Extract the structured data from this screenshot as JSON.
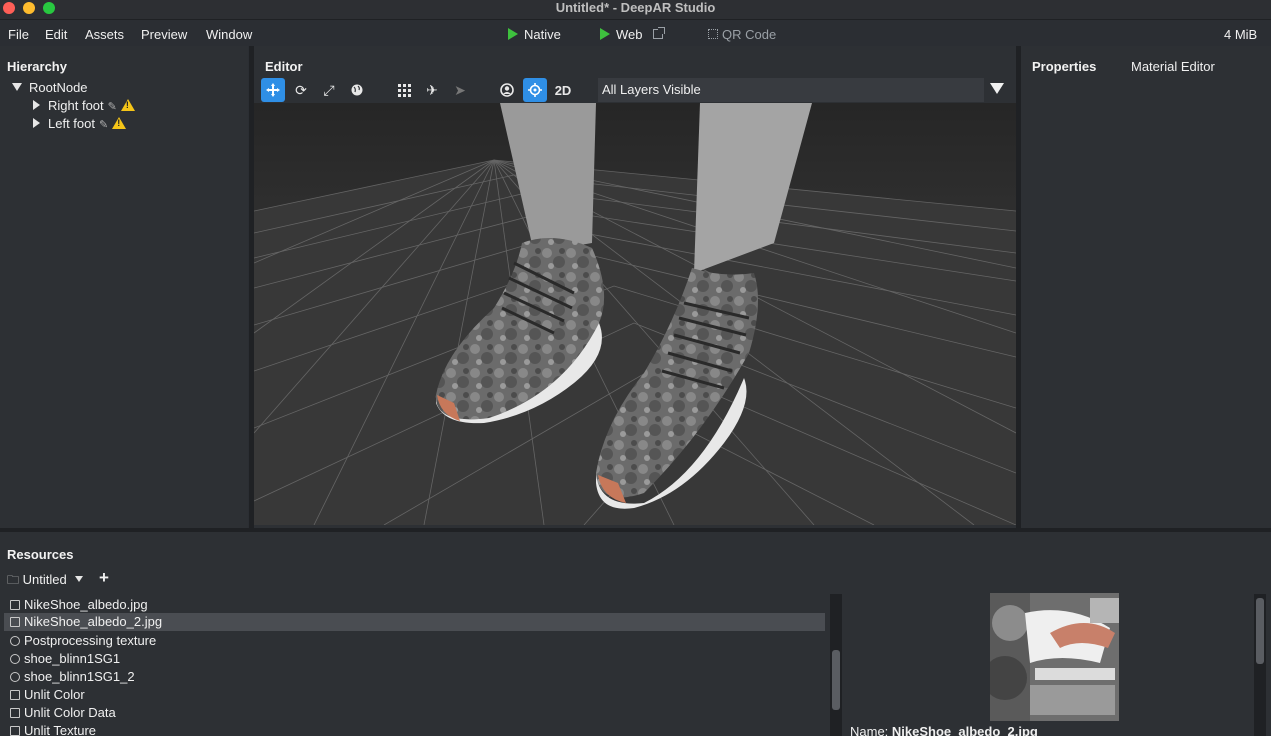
{
  "window": {
    "title": "Untitled* - DeepAR Studio"
  },
  "menu": {
    "items": [
      "File",
      "Edit",
      "Assets",
      "Preview",
      "Window"
    ],
    "native_label": "Native",
    "web_label": "Web",
    "qr_label": "QR Code",
    "memory": "4 MiB"
  },
  "hierarchy": {
    "title": "Hierarchy",
    "root": "RootNode",
    "children": [
      "Right foot",
      "Left foot"
    ]
  },
  "editor": {
    "title": "Editor",
    "mode_2d_label": "2D",
    "layers_selected": "All Layers Visible"
  },
  "properties": {
    "tab_properties": "Properties",
    "tab_material_editor": "Material Editor"
  },
  "resources": {
    "title": "Resources",
    "folder": "Untitled",
    "add_label": "+",
    "items": [
      {
        "label": "NikeShoe_albedo.jpg",
        "icon": "image-icon"
      },
      {
        "label": "NikeShoe_albedo_2.jpg",
        "icon": "image-icon"
      },
      {
        "label": "Postprocessing texture",
        "icon": "gear-icon"
      },
      {
        "label": "shoe_blinn1SG1",
        "icon": "sphere-icon"
      },
      {
        "label": "shoe_blinn1SG1_2",
        "icon": "sphere-icon"
      },
      {
        "label": "Unlit Color",
        "icon": "file-icon"
      },
      {
        "label": "Unlit Color Data",
        "icon": "folder-icon"
      },
      {
        "label": "Unlit Texture",
        "icon": "file-icon"
      }
    ],
    "selected_index": 1,
    "preview_name_label": "Name:",
    "preview_name_value": "NikeShoe_albedo_2.jpg"
  },
  "colors": {
    "accent": "#2f8fe6",
    "play": "#3ec13e",
    "warning": "#f5c518"
  }
}
